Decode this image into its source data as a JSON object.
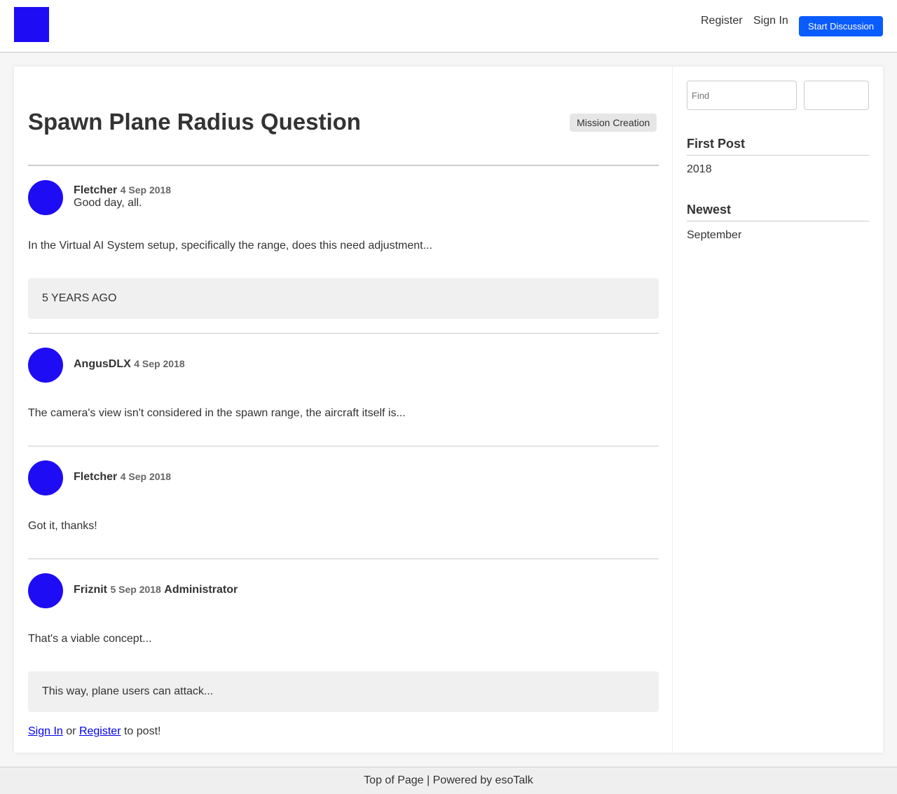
{
  "header": {
    "register_label": "Register",
    "signin_label": "Sign In",
    "start_discussion_label": "Start Discussion"
  },
  "discussion": {
    "title": "Spawn Plane Radius Question",
    "tag": "Mission Creation"
  },
  "posts": [
    {
      "author": "Fletcher",
      "date": "4 Sep 2018",
      "greeting": "Good day, all.",
      "body": "In the Virtual AI System setup, specifically the range, does this need adjustment...",
      "quote": "5 YEARS AGO"
    },
    {
      "author": "AngusDLX",
      "date": "4 Sep 2018",
      "body": "The camera's view isn't considered in the spawn range, the aircraft itself is..."
    },
    {
      "author": "Fletcher",
      "date": "4 Sep 2018",
      "body": "Got it, thanks!"
    },
    {
      "author": "Friznit",
      "date": "5 Sep 2018",
      "role": "Administrator",
      "body": "That's a viable concept...",
      "quote": "This way, plane users can attack..."
    }
  ],
  "reply": {
    "signin_link": "Sign In",
    "or_text": "or",
    "register_link": "Register",
    "suffix": "to post!"
  },
  "sidebar": {
    "find_placeholder": "Find",
    "first_post_heading": "First Post",
    "first_post_value": "2018",
    "newest_heading": "Newest",
    "newest_value": "September"
  },
  "footer": {
    "text": "Top of Page | Powered by esoTalk"
  },
  "colors": {
    "accent": "#0a5cff",
    "avatar": "#1e0cf5",
    "logo": "#1e0cf5"
  }
}
